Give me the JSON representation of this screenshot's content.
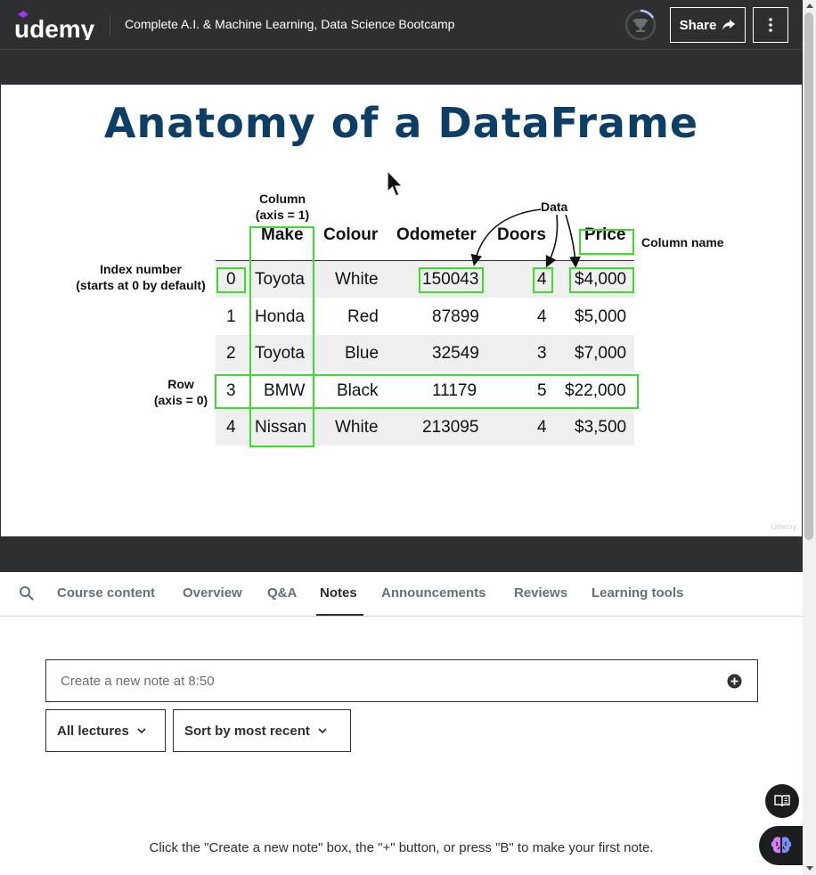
{
  "header": {
    "logo_text": "udemy",
    "course_title": "Complete A.I. & Machine Learning, Data Science Bootcamp",
    "share_label": "Share",
    "icons": {
      "progress": "trophy-icon",
      "share": "share-arrow-icon",
      "more": "vertical-dots-icon"
    }
  },
  "slide": {
    "title": "Anatomy of a DataFrame",
    "watermark": "Udemy",
    "annotations": {
      "column": "Column",
      "column_axis": "(axis = 1)",
      "data": "Data",
      "column_name": "Column name",
      "index_number": "Index number",
      "index_default": "(starts at 0 by default)",
      "row": "Row",
      "row_axis": "(axis = 0)"
    },
    "table": {
      "headers": [
        "Make",
        "Colour",
        "Odometer",
        "Doors",
        "Price"
      ],
      "rows": [
        {
          "index": "0",
          "make": "Toyota",
          "colour": "White",
          "odometer": "150043",
          "doors": "4",
          "price": "$4,000"
        },
        {
          "index": "1",
          "make": "Honda",
          "colour": "Red",
          "odometer": "87899",
          "doors": "4",
          "price": "$5,000"
        },
        {
          "index": "2",
          "make": "Toyota",
          "colour": "Blue",
          "odometer": "32549",
          "doors": "3",
          "price": "$7,000"
        },
        {
          "index": "3",
          "make": "BMW",
          "colour": "Black",
          "odometer": "11179",
          "doors": "5",
          "price": "$22,000"
        },
        {
          "index": "4",
          "make": "Nissan",
          "colour": "White",
          "odometer": "213095",
          "doors": "4",
          "price": "$3,500"
        }
      ]
    },
    "highlight_color": "#3ddc2f",
    "title_color": "#0d3f66"
  },
  "tabs": {
    "items": [
      "Course content",
      "Overview",
      "Q&A",
      "Notes",
      "Announcements",
      "Reviews",
      "Learning tools"
    ],
    "active": "Notes"
  },
  "notes": {
    "input_placeholder": "Create a new note at 8:50",
    "filter_lectures": "All lectures",
    "sort": "Sort by most recent",
    "empty_message": "Click the \"Create a new note\" box, the \"+\" button, or press \"B\" to make your first note."
  }
}
